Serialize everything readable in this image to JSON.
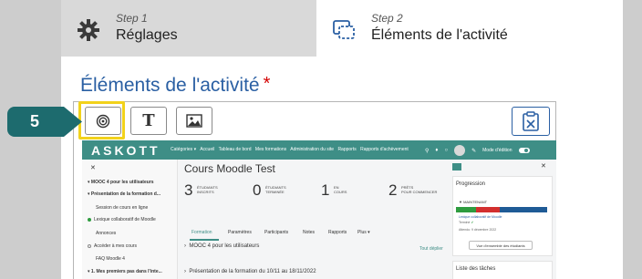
{
  "steps": [
    {
      "number": "Step 1",
      "title": "Réglages",
      "icon": "gear-icon"
    },
    {
      "number": "Step 2",
      "title": "Éléments de l'activité",
      "icon": "activity-elements-icon"
    }
  ],
  "section": {
    "heading": "Éléments de l'activité",
    "required_marker": "*"
  },
  "toolbar": {
    "buttons": [
      "target-icon",
      "text-icon",
      "image-icon"
    ],
    "text_button_label": "T",
    "clipboard_icon": "clipboard-icon"
  },
  "callout": {
    "number": "5"
  },
  "screenshot": {
    "logo": "ASKOTT",
    "nav": [
      "Catégories ▾",
      "Accueil",
      "Tableau de bord",
      "Mes formations",
      "Administration du site",
      "Rapports",
      "Rapports d'achèvement"
    ],
    "mode_label": "Mode d'édition",
    "leftnav": [
      "MOOC 4 pour les utilisateurs",
      "Présentation de la formation d...",
      "Session de cours en ligne",
      "Lexique collaboratif de Moodle",
      "Annonces",
      "Accéder à mes cours",
      "FAQ Moodle 4",
      "1. Mes premiers pas dans l'inte..."
    ],
    "course_title": "Cours Moodle Test",
    "stats": [
      {
        "value": "3",
        "label1": "ÉTUDIANTS",
        "label2": "INSCRITS"
      },
      {
        "value": "0",
        "label1": "ÉTUDIANTS",
        "label2": "TERMINÉE"
      },
      {
        "value": "1",
        "label1": "EN",
        "label2": "COURS"
      },
      {
        "value": "2",
        "label1": "PRÊTS",
        "label2": "POUR COMMENCER"
      }
    ],
    "tabs": [
      "Formation",
      "Paramètres",
      "Participants",
      "Notes",
      "Rapports",
      "Plus ▾"
    ],
    "sections": [
      "MOOC 4 pour les utilisateurs",
      "Présentation de la formation du 10/11 au 18/11/2022"
    ],
    "expand_all": "Tout déplier",
    "progress_title": "Progression",
    "progress_now": "▼ MAINTENANT",
    "progress_item": "Lexique collaboratif de Moodle",
    "progress_status": "Terminé",
    "progress_date": "Attendu: 9 décembre 2022",
    "progress_button": "Vue d'ensemble des étudiants",
    "tasks_title": "Liste des tâches",
    "accent": "#3e8e86"
  }
}
